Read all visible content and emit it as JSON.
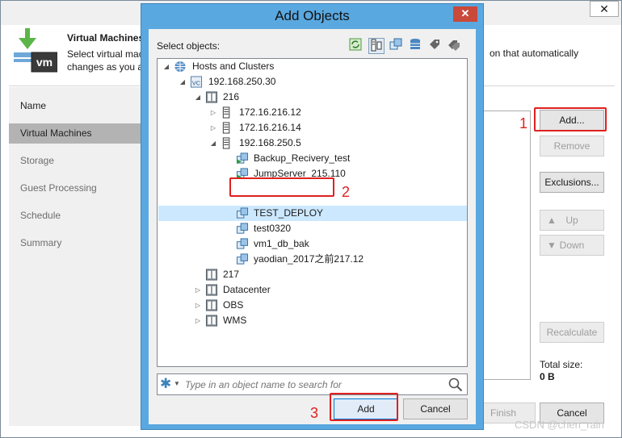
{
  "wizard": {
    "close_glyph": "✕",
    "title": "Virtual Machines",
    "description_left": "Select virtual mac\nchanges as you a",
    "description_right": "on that automatically",
    "steps": [
      "Name",
      "Virtual Machines",
      "Storage",
      "Guest Processing",
      "Schedule",
      "Summary"
    ],
    "active_step": "Virtual Machines",
    "buttons": {
      "add": "Add...",
      "remove": "Remove",
      "exclusions": "Exclusions...",
      "up": "Up",
      "down": "Down",
      "recalculate": "Recalculate",
      "finish": "Finish",
      "cancel": "Cancel"
    },
    "total_size_label": "Total size:",
    "total_size_value": "0 B"
  },
  "dialog": {
    "title": "Add Objects",
    "close_glyph": "✕",
    "select_label": "Select objects:",
    "toolbar_icons": [
      "refresh-icon",
      "hosts-clusters-view-icon",
      "vms-templates-view-icon",
      "datastores-view-icon",
      "tags-view-icon",
      "tag-categories-view-icon"
    ],
    "tree": [
      {
        "label": "Hosts and Clusters",
        "icon": "globe-icon",
        "level": 0,
        "expanded": true
      },
      {
        "label": "192.168.250.30",
        "icon": "vcenter-icon",
        "level": 1,
        "expanded": true
      },
      {
        "label": "216",
        "icon": "folder-icon",
        "level": 2,
        "expanded": true
      },
      {
        "label": "172.16.216.12",
        "icon": "host-icon",
        "level": 3,
        "expanded": false
      },
      {
        "label": "172.16.216.14",
        "icon": "host-icon",
        "level": 3,
        "expanded": false
      },
      {
        "label": "192.168.250.5",
        "icon": "host-icon",
        "level": 3,
        "expanded": true
      },
      {
        "label": "Backup_Recivery_test",
        "icon": "vm-running-icon",
        "level": 4
      },
      {
        "label": "JumpServer_215.110",
        "icon": "vm-running-icon",
        "level": 4
      },
      {
        "label": "TEST_DEPLOY",
        "icon": "vm-icon",
        "level": 4,
        "selected": true
      },
      {
        "label": "test0320",
        "icon": "vm-icon",
        "level": 4
      },
      {
        "label": "vm1_db_bak",
        "icon": "vm-icon",
        "level": 4
      },
      {
        "label": "yaodian_2017之前217.12",
        "icon": "vm-icon",
        "level": 4
      },
      {
        "label": "217",
        "icon": "folder-icon",
        "level": 2
      },
      {
        "label": "Datacenter",
        "icon": "folder-icon",
        "level": 2,
        "expanded": false
      },
      {
        "label": "OBS",
        "icon": "folder-icon",
        "level": 2,
        "expanded": false
      },
      {
        "label": "WMS",
        "icon": "folder-icon",
        "level": 2,
        "expanded": false
      }
    ],
    "search": {
      "placeholder": "Type in an object name to search for",
      "value": ""
    },
    "buttons": {
      "add": "Add",
      "cancel": "Cancel"
    }
  },
  "annotations": {
    "n1": "1",
    "n2": "2",
    "n3": "3"
  },
  "watermark": "CSDN @chen_rain",
  "colors": {
    "dialog_frame": "#5aa8e0",
    "selection": "#cce8ff",
    "annotation": "#e02020",
    "active_step": "#b3b3b3"
  }
}
